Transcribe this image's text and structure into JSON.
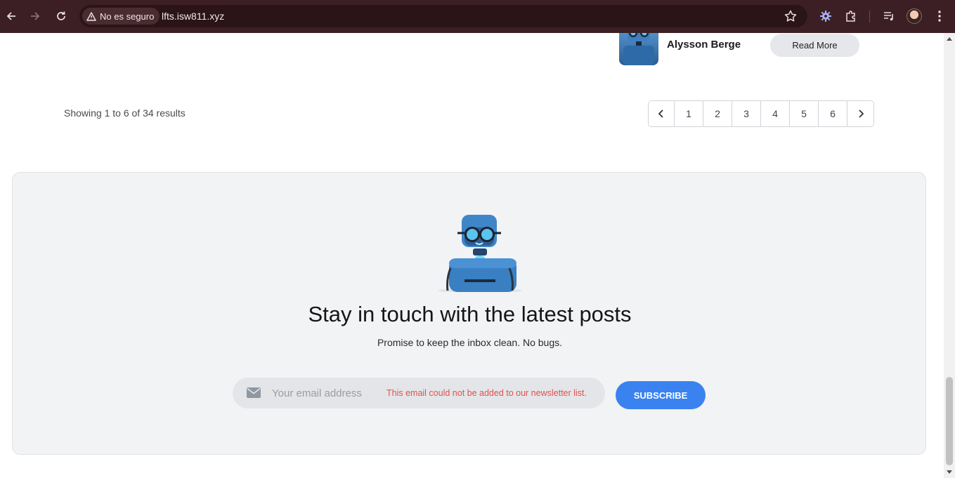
{
  "browser": {
    "security_label": "No es seguro",
    "url": "lfts.isw811.xyz"
  },
  "post": {
    "author_name": "Alysson Berge",
    "read_more_label": "Read More"
  },
  "pagination": {
    "summary": "Showing 1 to 6 of 34 results",
    "pages": [
      "1",
      "2",
      "3",
      "4",
      "5",
      "6"
    ]
  },
  "newsletter": {
    "title": "Stay in touch with the latest posts",
    "subtitle": "Promise to keep the inbox clean. No bugs.",
    "email_placeholder": "Your email address",
    "error_message": "This email could not be added to our newsletter list.",
    "subscribe_label": "SUBSCRIBE"
  },
  "colors": {
    "chrome_bg": "#3c1f24",
    "accent_blue": "#3a82f0",
    "error_red": "#e05050"
  }
}
